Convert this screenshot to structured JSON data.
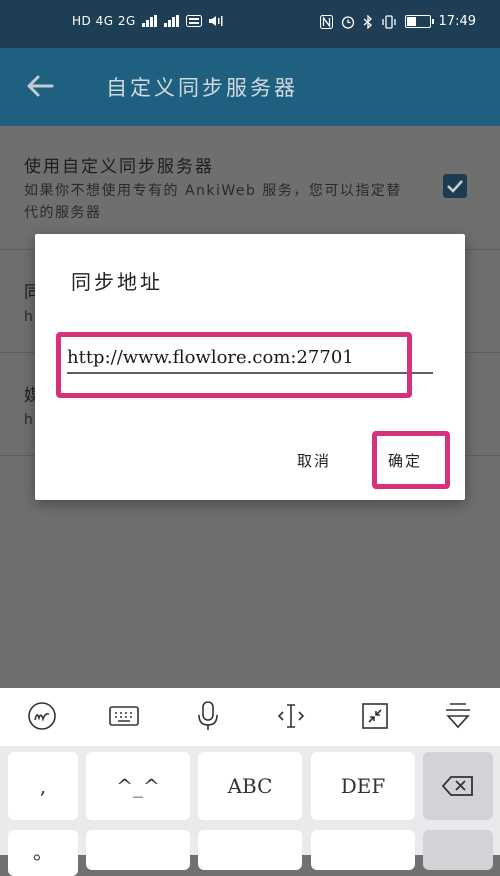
{
  "status_bar": {
    "network_left": "HD 4G 2G",
    "time": "17:49",
    "battery_level": 0.45
  },
  "app_bar": {
    "title": "自定义同步服务器"
  },
  "preferences": [
    {
      "title": "使用自定义同步服务器",
      "summary": "如果你不想使用专有的 AnkiWeb 服务，您可以指定替代的服务器",
      "checked": true
    },
    {
      "title_partial": "同",
      "summary_partial": "ht"
    },
    {
      "title_partial": "媒",
      "summary_partial": "ht"
    }
  ],
  "dialog": {
    "title": "同步地址",
    "url_value": "http://www.flowlore.com:27701",
    "cancel_label": "取消",
    "ok_label": "确定",
    "highlight_color": "#d6317d"
  },
  "keyboard_toolbar": [
    {
      "name": "handwriting-mode",
      "icon": "handwriting-icon"
    },
    {
      "name": "keyboard-layout",
      "icon": "keyboard-icon"
    },
    {
      "name": "voice-input",
      "icon": "microphone-icon"
    },
    {
      "name": "cursor-move",
      "icon": "text-cursor-icon"
    },
    {
      "name": "resize",
      "icon": "collapse-arrows-icon"
    },
    {
      "name": "hide-keyboard",
      "icon": "hide-keyboard-icon"
    }
  ],
  "keyboard": {
    "keys": [
      ",",
      "^_^",
      "ABC",
      "DEF"
    ],
    "side_key": "。"
  }
}
